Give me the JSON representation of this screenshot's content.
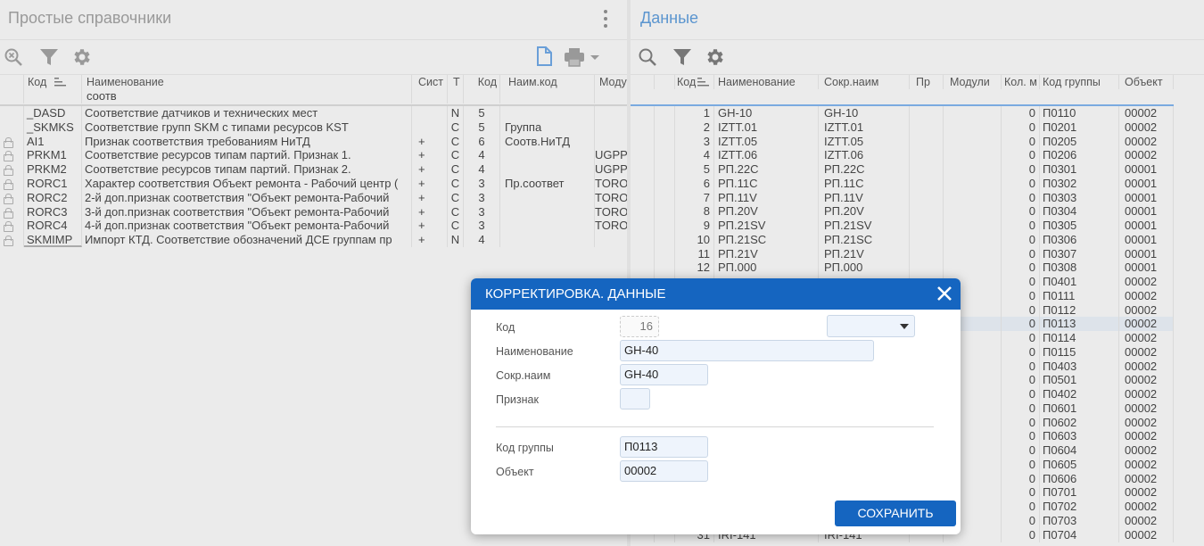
{
  "left": {
    "title": "Простые справочники",
    "filter_text": "соотв",
    "columns": [
      {
        "label": "Код"
      },
      {
        "label": "Наименование"
      },
      {
        "label": "Сист"
      },
      {
        "label": "Т"
      },
      {
        "label": "Код"
      },
      {
        "label": "Наим.код"
      },
      {
        "label": "Моду"
      }
    ],
    "rows": [
      {
        "locked": false,
        "code": "_DASD",
        "name": "Соответствие датчиков и технических мест",
        "sys": "",
        "type": "N",
        "kod": "5",
        "naim": "",
        "mod": ""
      },
      {
        "locked": false,
        "code": "_SKMKS",
        "name": "Соответствие групп SKM с типами ресурсов KST",
        "sys": "",
        "type": "C",
        "kod": "5",
        "naim": "Группа",
        "mod": ""
      },
      {
        "locked": true,
        "code": "AI1",
        "name": "Признак соответствия требованиям НиТД",
        "sys": "+",
        "type": "C",
        "kod": "6",
        "naim": "Соотв.НиТД",
        "mod": ""
      },
      {
        "locked": true,
        "code": "PRKM1",
        "name": "Соответствие ресурсов типам партий. Признак 1.",
        "sys": "+",
        "type": "C",
        "kod": "4",
        "naim": "",
        "mod": "UGPP"
      },
      {
        "locked": true,
        "code": "PRKM2",
        "name": "Соответствие ресурсов типам партий. Признак 2.",
        "sys": "+",
        "type": "C",
        "kod": "4",
        "naim": "",
        "mod": "UGPP"
      },
      {
        "locked": true,
        "code": "RORC1",
        "name": "Характер соответствия Объект ремонта - Рабочий центр (",
        "sys": "+",
        "type": "C",
        "kod": "3",
        "naim": "Пр.соответ",
        "mod": "TORO"
      },
      {
        "locked": true,
        "code": "RORC2",
        "name": "2-й доп.признак соответствия \"Объект ремонта-Рабочий",
        "sys": "+",
        "type": "C",
        "kod": "3",
        "naim": "",
        "mod": "TORO"
      },
      {
        "locked": true,
        "code": "RORC3",
        "name": "3-й доп.признак соответствия \"Объект ремонта-Рабочий",
        "sys": "+",
        "type": "C",
        "kod": "3",
        "naim": "",
        "mod": "TORO"
      },
      {
        "locked": true,
        "code": "RORC4",
        "name": "4-й доп.признак соответствия \"Объект ремонта-Рабочий",
        "sys": "+",
        "type": "C",
        "kod": "3",
        "naim": "",
        "mod": "TORO"
      },
      {
        "locked": true,
        "code": "SKMIMP",
        "name": "Импорт КТД. Соответствие обозначений ДСЕ группам пр",
        "sys": "+",
        "type": "N",
        "kod": "4",
        "naim": "",
        "mod": ""
      }
    ]
  },
  "right": {
    "title": "Данные",
    "columns": [
      {
        "label": "Код"
      },
      {
        "label": "Наименование"
      },
      {
        "label": "Сокр.наим"
      },
      {
        "label": "Пр"
      },
      {
        "label": "Модули"
      },
      {
        "label": "Кол. м"
      },
      {
        "label": "Код группы"
      },
      {
        "label": "Объект"
      }
    ],
    "rows": [
      {
        "kod": "1",
        "name": "GH-10",
        "short": "GH-10",
        "pr": "",
        "mod": "",
        "qty": "0",
        "group": "П0110",
        "obj": "00002"
      },
      {
        "kod": "2",
        "name": "IZTT.01",
        "short": "IZTT.01",
        "pr": "",
        "mod": "",
        "qty": "0",
        "group": "П0201",
        "obj": "00002"
      },
      {
        "kod": "3",
        "name": "IZTT.05",
        "short": "IZTT.05",
        "pr": "",
        "mod": "",
        "qty": "0",
        "group": "П0205",
        "obj": "00002"
      },
      {
        "kod": "4",
        "name": "IZTT.06",
        "short": "IZTT.06",
        "pr": "",
        "mod": "",
        "qty": "0",
        "group": "П0206",
        "obj": "00002"
      },
      {
        "kod": "5",
        "name": "РП.22С",
        "short": "РП.22С",
        "pr": "",
        "mod": "",
        "qty": "0",
        "group": "П0301",
        "obj": "00001"
      },
      {
        "kod": "6",
        "name": "РП.11С",
        "short": "РП.11С",
        "pr": "",
        "mod": "",
        "qty": "0",
        "group": "П0302",
        "obj": "00001"
      },
      {
        "kod": "7",
        "name": "РП.11V",
        "short": "РП.11V",
        "pr": "",
        "mod": "",
        "qty": "0",
        "group": "П0303",
        "obj": "00001"
      },
      {
        "kod": "8",
        "name": "РП.20V",
        "short": "РП.20V",
        "pr": "",
        "mod": "",
        "qty": "0",
        "group": "П0304",
        "obj": "00001"
      },
      {
        "kod": "9",
        "name": "РП.21SV",
        "short": "РП.21SV",
        "pr": "",
        "mod": "",
        "qty": "0",
        "group": "П0305",
        "obj": "00001"
      },
      {
        "kod": "10",
        "name": "РП.21SC",
        "short": "РП.21SC",
        "pr": "",
        "mod": "",
        "qty": "0",
        "group": "П0306",
        "obj": "00001"
      },
      {
        "kod": "11",
        "name": "РП.21V",
        "short": "РП.21V",
        "pr": "",
        "mod": "",
        "qty": "0",
        "group": "П0307",
        "obj": "00001"
      },
      {
        "kod": "12",
        "name": "РП.000",
        "short": "РП.000",
        "pr": "",
        "mod": "",
        "qty": "0",
        "group": "П0308",
        "obj": "00001"
      },
      {
        "kod": "",
        "name": "",
        "short": "",
        "pr": "",
        "mod": "",
        "qty": "0",
        "group": "П0401",
        "obj": "00002"
      },
      {
        "kod": "",
        "name": "",
        "short": "",
        "pr": "",
        "mod": "",
        "qty": "0",
        "group": "П0111",
        "obj": "00002"
      },
      {
        "kod": "",
        "name": "",
        "short": "",
        "pr": "",
        "mod": "",
        "qty": "0",
        "group": "П0112",
        "obj": "00002"
      },
      {
        "kod": "",
        "name": "",
        "short": "",
        "pr": "",
        "mod": "",
        "qty": "0",
        "group": "П0113",
        "obj": "00002"
      },
      {
        "kod": "",
        "name": "",
        "short": "",
        "pr": "",
        "mod": "",
        "qty": "0",
        "group": "П0114",
        "obj": "00002"
      },
      {
        "kod": "",
        "name": "",
        "short": "",
        "pr": "",
        "mod": "",
        "qty": "0",
        "group": "П0115",
        "obj": "00002"
      },
      {
        "kod": "",
        "name": "",
        "short": "",
        "pr": "",
        "mod": "",
        "qty": "0",
        "group": "П0403",
        "obj": "00002"
      },
      {
        "kod": "",
        "name": "",
        "short": "",
        "pr": "",
        "mod": "",
        "qty": "0",
        "group": "П0501",
        "obj": "00002"
      },
      {
        "kod": "",
        "name": "",
        "short": "",
        "pr": "",
        "mod": "",
        "qty": "0",
        "group": "П0402",
        "obj": "00002"
      },
      {
        "kod": "",
        "name": "",
        "short": "",
        "pr": "",
        "mod": "",
        "qty": "0",
        "group": "П0601",
        "obj": "00002"
      },
      {
        "kod": "",
        "name": "",
        "short": "",
        "pr": "",
        "mod": "",
        "qty": "0",
        "group": "П0602",
        "obj": "00002"
      },
      {
        "kod": "",
        "name": "",
        "short": "",
        "pr": "",
        "mod": "",
        "qty": "0",
        "group": "П0603",
        "obj": "00002"
      },
      {
        "kod": "",
        "name": "",
        "short": "",
        "pr": "",
        "mod": "",
        "qty": "0",
        "group": "П0604",
        "obj": "00002"
      },
      {
        "kod": "",
        "name": "",
        "short": "",
        "pr": "",
        "mod": "",
        "qty": "0",
        "group": "П0605",
        "obj": "00002"
      },
      {
        "kod": "",
        "name": "",
        "short": "",
        "pr": "",
        "mod": "",
        "qty": "0",
        "group": "П0606",
        "obj": "00002"
      },
      {
        "kod": "",
        "name": "",
        "short": "",
        "pr": "",
        "mod": "",
        "qty": "0",
        "group": "П0701",
        "obj": "00002"
      },
      {
        "kod": "",
        "name": "",
        "short": "",
        "pr": "",
        "mod": "",
        "qty": "0",
        "group": "П0702",
        "obj": "00002"
      },
      {
        "kod": "",
        "name": "",
        "short": "",
        "pr": "",
        "mod": "",
        "qty": "0",
        "group": "П0703",
        "obj": "00002"
      },
      {
        "kod": "31",
        "name": "IRI-141",
        "short": "IRI-141",
        "pr": "",
        "mod": "",
        "qty": "0",
        "group": "П0704",
        "obj": "00002"
      }
    ],
    "selected_index": 15
  },
  "dialog": {
    "title": "КОРРЕКТИРОВКА. ДАННЫЕ",
    "fields": [
      {
        "label": "Код",
        "value": "16"
      },
      {
        "label": "Наименование",
        "value": "GH-40"
      },
      {
        "label": "Сокр.наим",
        "value": "GH-40"
      },
      {
        "label": "Признак",
        "value": ""
      },
      {
        "label": "Код группы",
        "value": "П0113"
      },
      {
        "label": "Объект",
        "value": "00002"
      }
    ],
    "select_value": "",
    "save_label": "СОХРАНИТЬ"
  },
  "colors": {
    "accent": "#1565c0",
    "right_title": "#5b95cf",
    "selection": "#dde3ea"
  },
  "icons": [
    "zoom-reset-icon",
    "filter-icon",
    "gear-icon",
    "document-icon",
    "print-icon",
    "search-icon",
    "close-icon",
    "chevron-down-icon"
  ]
}
